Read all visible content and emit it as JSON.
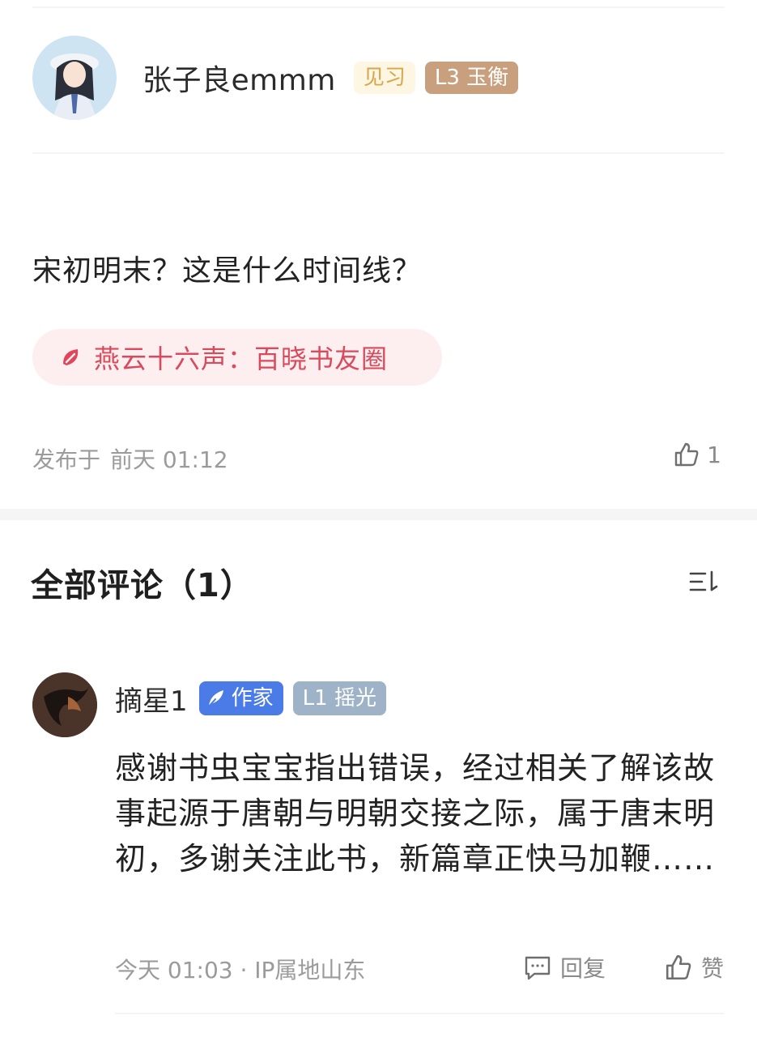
{
  "post": {
    "author": "张子良emmm",
    "badge_intern": "见习",
    "badge_level": "L3 玉衡",
    "text": "宋初明末？这是什么时间线？",
    "topic": "燕云十六声：百晓书友圈",
    "published_label": "发布于",
    "published_time": "前天 01:12",
    "like_count": "1"
  },
  "comments_header": {
    "title": "全部评论（1）"
  },
  "comment": {
    "author": "摘星1",
    "badge_writer": "作家",
    "badge_level": "L1 摇光",
    "body": "感谢书虫宝宝指出错误，经过相关了解该故事起源于唐朝与明朝交接之际，属于唐末明初，多谢关注此书，新篇章正快马加鞭……",
    "meta": "今天 01:03 · IP属地山东",
    "reply_label": "回复",
    "like_label": "赞"
  },
  "colors": {
    "topic_text": "#d94a5c",
    "topic_bg": "#fdeff0",
    "badge_writer_bg": "#4a7be6",
    "badge_level_gold": "#c9a07d",
    "badge_level_blue": "#9eb2c8"
  },
  "icons": {
    "like": "thumbs-up-icon",
    "reply": "chat-bubble-icon",
    "sort": "sort-icon",
    "topic": "topic-leaf-icon",
    "writer": "feather-icon"
  }
}
